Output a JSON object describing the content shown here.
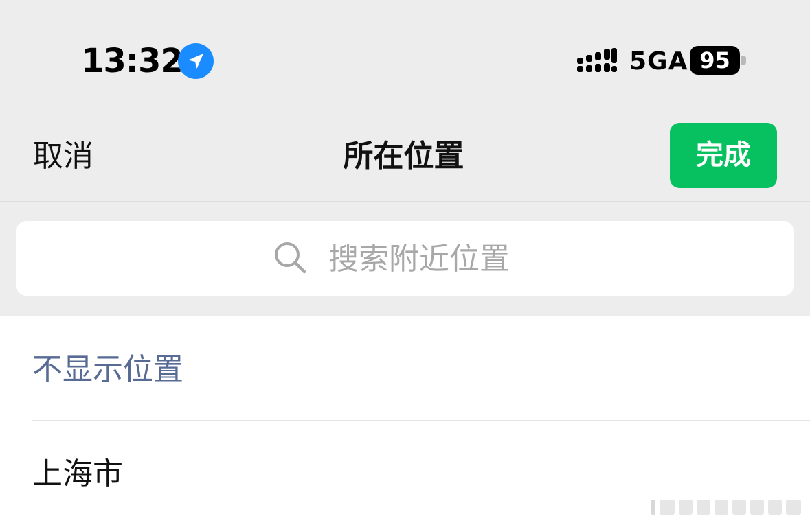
{
  "status_bar": {
    "time": "13:32",
    "location_icon": "location-arrow-icon",
    "signal_icon": "cellular-signal-icon",
    "network": "5GA",
    "battery": "95"
  },
  "nav": {
    "cancel_label": "取消",
    "title": "所在位置",
    "done_label": "完成",
    "accent_color": "#07c160"
  },
  "search": {
    "icon": "search-icon",
    "placeholder": "搜索附近位置"
  },
  "list": {
    "items": [
      {
        "label": "不显示位置",
        "color": "#576b95"
      },
      {
        "label": "上海市",
        "color": "#111111"
      }
    ]
  }
}
